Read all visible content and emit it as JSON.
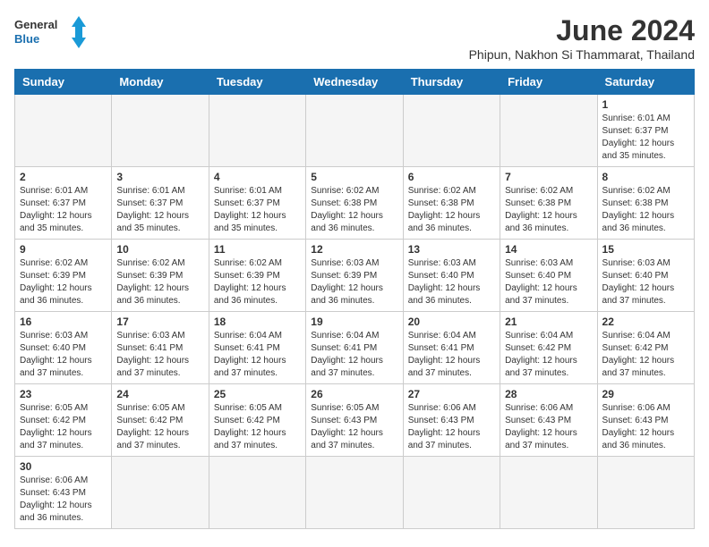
{
  "logo": {
    "line1": "General",
    "line2": "Blue"
  },
  "title": "June 2024",
  "subtitle": "Phipun, Nakhon Si Thammarat, Thailand",
  "days_of_week": [
    "Sunday",
    "Monday",
    "Tuesday",
    "Wednesday",
    "Thursday",
    "Friday",
    "Saturday"
  ],
  "weeks": [
    [
      null,
      null,
      null,
      null,
      null,
      null,
      {
        "day": 1,
        "sunrise": "6:01 AM",
        "sunset": "6:37 PM",
        "daylight": "12 hours and 35 minutes."
      }
    ],
    [
      {
        "day": 2,
        "sunrise": "6:01 AM",
        "sunset": "6:37 PM",
        "daylight": "12 hours and 35 minutes."
      },
      {
        "day": 3,
        "sunrise": "6:01 AM",
        "sunset": "6:37 PM",
        "daylight": "12 hours and 35 minutes."
      },
      {
        "day": 4,
        "sunrise": "6:01 AM",
        "sunset": "6:37 PM",
        "daylight": "12 hours and 35 minutes."
      },
      {
        "day": 5,
        "sunrise": "6:02 AM",
        "sunset": "6:38 PM",
        "daylight": "12 hours and 36 minutes."
      },
      {
        "day": 6,
        "sunrise": "6:02 AM",
        "sunset": "6:38 PM",
        "daylight": "12 hours and 36 minutes."
      },
      {
        "day": 7,
        "sunrise": "6:02 AM",
        "sunset": "6:38 PM",
        "daylight": "12 hours and 36 minutes."
      },
      {
        "day": 8,
        "sunrise": "6:02 AM",
        "sunset": "6:38 PM",
        "daylight": "12 hours and 36 minutes."
      }
    ],
    [
      {
        "day": 9,
        "sunrise": "6:02 AM",
        "sunset": "6:39 PM",
        "daylight": "12 hours and 36 minutes."
      },
      {
        "day": 10,
        "sunrise": "6:02 AM",
        "sunset": "6:39 PM",
        "daylight": "12 hours and 36 minutes."
      },
      {
        "day": 11,
        "sunrise": "6:02 AM",
        "sunset": "6:39 PM",
        "daylight": "12 hours and 36 minutes."
      },
      {
        "day": 12,
        "sunrise": "6:03 AM",
        "sunset": "6:39 PM",
        "daylight": "12 hours and 36 minutes."
      },
      {
        "day": 13,
        "sunrise": "6:03 AM",
        "sunset": "6:40 PM",
        "daylight": "12 hours and 36 minutes."
      },
      {
        "day": 14,
        "sunrise": "6:03 AM",
        "sunset": "6:40 PM",
        "daylight": "12 hours and 37 minutes."
      },
      {
        "day": 15,
        "sunrise": "6:03 AM",
        "sunset": "6:40 PM",
        "daylight": "12 hours and 37 minutes."
      }
    ],
    [
      {
        "day": 16,
        "sunrise": "6:03 AM",
        "sunset": "6:40 PM",
        "daylight": "12 hours and 37 minutes."
      },
      {
        "day": 17,
        "sunrise": "6:03 AM",
        "sunset": "6:41 PM",
        "daylight": "12 hours and 37 minutes."
      },
      {
        "day": 18,
        "sunrise": "6:04 AM",
        "sunset": "6:41 PM",
        "daylight": "12 hours and 37 minutes."
      },
      {
        "day": 19,
        "sunrise": "6:04 AM",
        "sunset": "6:41 PM",
        "daylight": "12 hours and 37 minutes."
      },
      {
        "day": 20,
        "sunrise": "6:04 AM",
        "sunset": "6:41 PM",
        "daylight": "12 hours and 37 minutes."
      },
      {
        "day": 21,
        "sunrise": "6:04 AM",
        "sunset": "6:42 PM",
        "daylight": "12 hours and 37 minutes."
      },
      {
        "day": 22,
        "sunrise": "6:04 AM",
        "sunset": "6:42 PM",
        "daylight": "12 hours and 37 minutes."
      }
    ],
    [
      {
        "day": 23,
        "sunrise": "6:05 AM",
        "sunset": "6:42 PM",
        "daylight": "12 hours and 37 minutes."
      },
      {
        "day": 24,
        "sunrise": "6:05 AM",
        "sunset": "6:42 PM",
        "daylight": "12 hours and 37 minutes."
      },
      {
        "day": 25,
        "sunrise": "6:05 AM",
        "sunset": "6:42 PM",
        "daylight": "12 hours and 37 minutes."
      },
      {
        "day": 26,
        "sunrise": "6:05 AM",
        "sunset": "6:43 PM",
        "daylight": "12 hours and 37 minutes."
      },
      {
        "day": 27,
        "sunrise": "6:06 AM",
        "sunset": "6:43 PM",
        "daylight": "12 hours and 37 minutes."
      },
      {
        "day": 28,
        "sunrise": "6:06 AM",
        "sunset": "6:43 PM",
        "daylight": "12 hours and 37 minutes."
      },
      {
        "day": 29,
        "sunrise": "6:06 AM",
        "sunset": "6:43 PM",
        "daylight": "12 hours and 36 minutes."
      }
    ],
    [
      {
        "day": 30,
        "sunrise": "6:06 AM",
        "sunset": "6:43 PM",
        "daylight": "12 hours and 36 minutes."
      },
      null,
      null,
      null,
      null,
      null,
      null
    ]
  ]
}
